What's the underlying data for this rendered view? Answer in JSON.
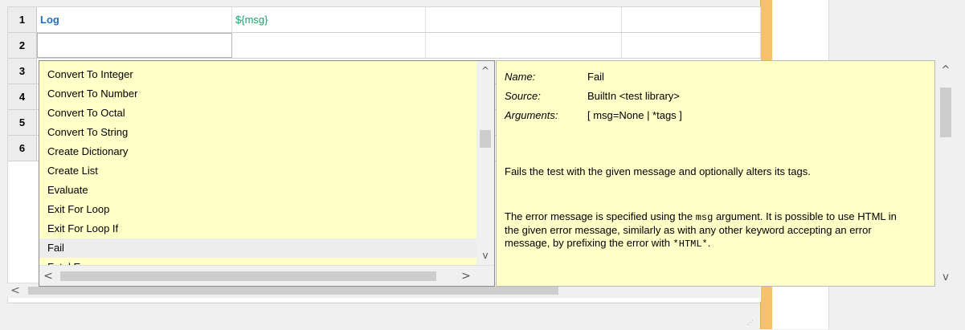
{
  "grid": {
    "rows": [
      {
        "num": "1",
        "cells": [
          "Log",
          "${msg}",
          "",
          ""
        ]
      },
      {
        "num": "2",
        "cells": [
          "",
          "",
          "",
          ""
        ]
      },
      {
        "num": "3",
        "cells": [
          "",
          "",
          "",
          ""
        ]
      },
      {
        "num": "4",
        "cells": [
          "",
          "",
          "",
          ""
        ]
      },
      {
        "num": "5",
        "cells": [
          "",
          "",
          "",
          ""
        ]
      },
      {
        "num": "6",
        "cells": [
          "",
          "",
          "",
          ""
        ]
      }
    ]
  },
  "scroll": {
    "left_arrow": "<",
    "right_arrow": ">",
    "up_arrow": "^",
    "down_arrow": "v"
  },
  "autocomplete": {
    "items": [
      "Convert To Integer",
      "Convert To Number",
      "Convert To Octal",
      "Convert To String",
      "Create Dictionary",
      "Create List",
      "Evaluate",
      "Exit For Loop",
      "Exit For Loop If",
      "Fail",
      "Fatal Error"
    ],
    "selected": "Fail"
  },
  "details": {
    "name_label": "Name:",
    "name_value": "Fail",
    "source_label": "Source:",
    "source_value": "BuiltIn <test library>",
    "arguments_label": "Arguments:",
    "arguments_value": "[ msg=None | *tags ]",
    "summary": "Fails the test with the given message and optionally alters its tags.",
    "desc_part1": "The error message is specified using the ",
    "desc_code1": "msg",
    "desc_part2": " argument. It is possible to use HTML in the given error message, similarly as with any other keyword accepting an error message, by prefixing the error with ",
    "desc_code2": "*HTML*",
    "desc_part3": "."
  }
}
